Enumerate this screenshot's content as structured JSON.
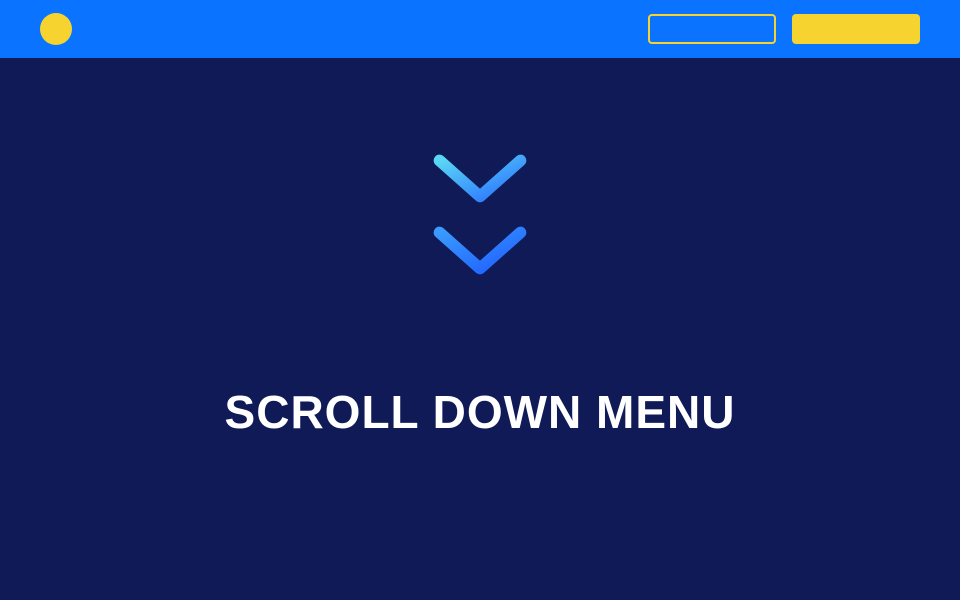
{
  "header": {
    "logo": "circle-logo",
    "nav_outline_label": "",
    "nav_solid_label": ""
  },
  "content": {
    "icon": "double-chevron-down",
    "title": "SCROLL DOWN MENU"
  },
  "colors": {
    "header_bg": "#0a73ff",
    "body_bg": "#0f1a56",
    "accent": "#f7d32f",
    "chevron_gradient_start": "#5ad7f5",
    "chevron_gradient_end": "#1e5eff"
  }
}
